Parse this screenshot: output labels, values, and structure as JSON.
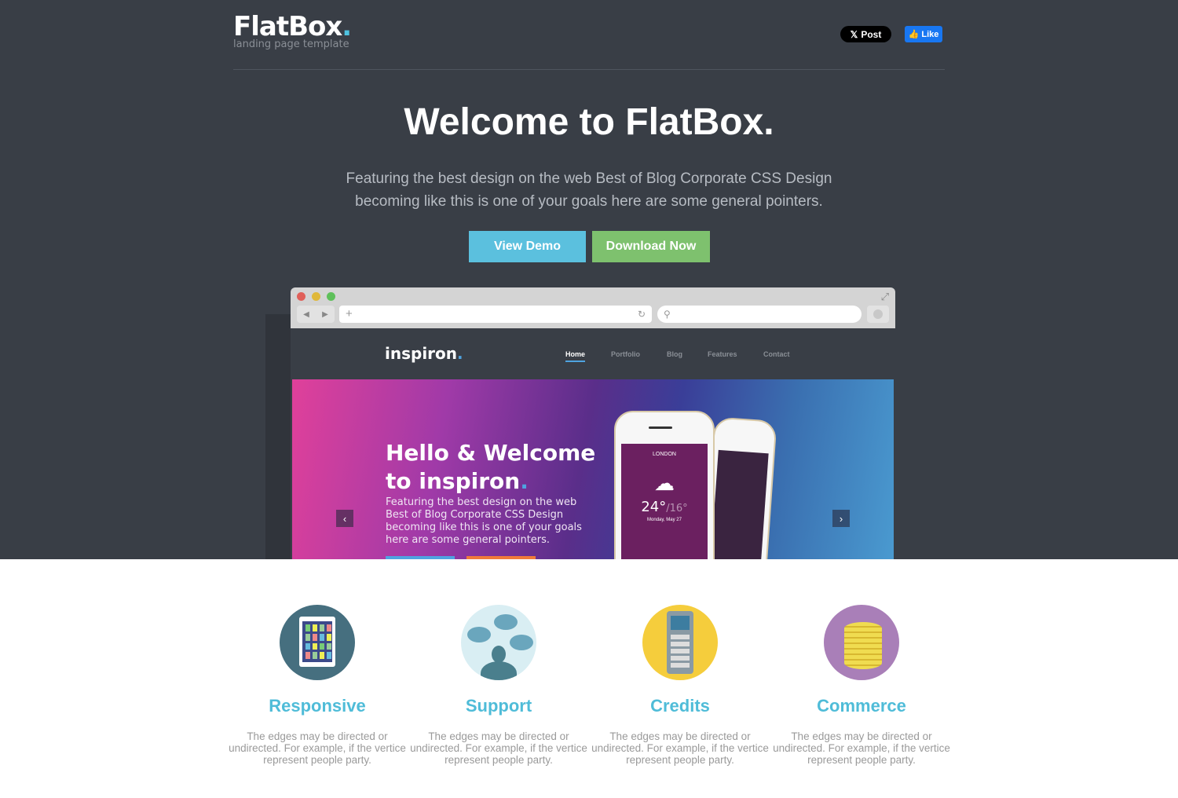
{
  "header": {
    "logo": "FlatBox",
    "logo_dot": ".",
    "tagline": "landing page template",
    "x_post": "Post",
    "fb_like": "Like"
  },
  "hero": {
    "title": "Welcome to FlatBox.",
    "lead": "Featuring the best design on the web Best of Blog Corporate CSS Design becoming like this is one of your goals here are some general pointers.",
    "view_demo": "View Demo",
    "download": "Download Now"
  },
  "mockup": {
    "logo": "inspiron",
    "logo_dot": ".",
    "nav": [
      "Home",
      "Portfolio",
      "Blog",
      "Features",
      "Contact"
    ],
    "active": "Home",
    "hero_title_1": "Hello & Welcome",
    "hero_title_2": "to inspiron",
    "hero_dot": ".",
    "hero_text": "Featuring the best design on the web Best of Blog Corporate CSS Design becoming like this is one of your goals here are some general pointers.",
    "phone_city": "LONDON",
    "phone_temp": "24°",
    "phone_low": "/16°",
    "phone_date": "Monday, May 27"
  },
  "features": [
    {
      "title": "Responsive",
      "text": "The edges may be directed or undirected. For example, if the vertice represent people party.",
      "icon": "tablet-icon",
      "color": "#466f7f"
    },
    {
      "title": "Support",
      "text": "The edges may be directed or undirected. For example, if the vertice represent people party.",
      "icon": "chat-support-icon",
      "color": "#d9eef3"
    },
    {
      "title": "Credits",
      "text": "The edges may be directed or undirected. For example, if the vertice represent people party.",
      "icon": "phone-keypad-icon",
      "color": "#f5cd3c"
    },
    {
      "title": "Commerce",
      "text": "The edges may be directed or undirected. For example, if the vertice represent people party.",
      "icon": "coins-icon",
      "color": "#a97fb8"
    }
  ],
  "colors": {
    "background": "#393e46",
    "accent": "#4fbcd8",
    "demo_button": "#5bc0de",
    "download_button": "#7ec16e"
  }
}
